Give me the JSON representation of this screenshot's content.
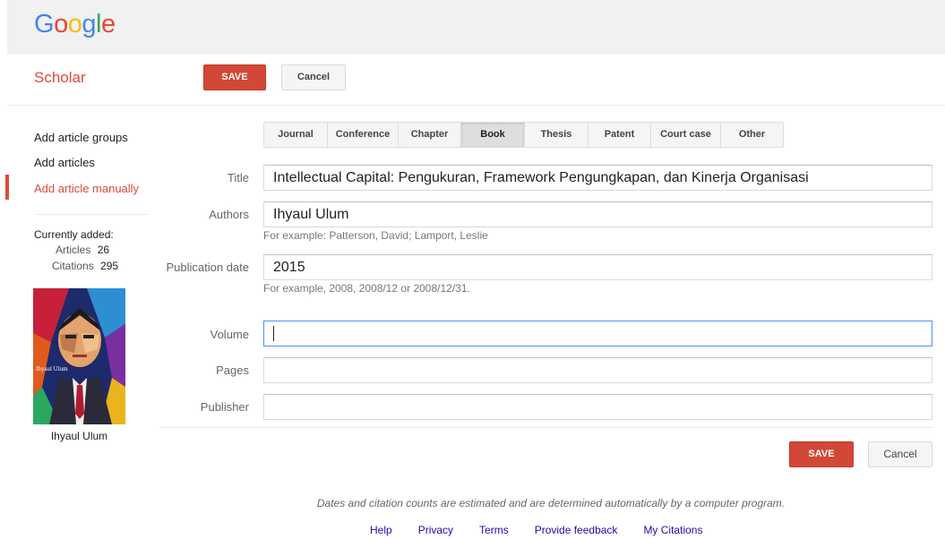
{
  "header": {
    "logo_letters": [
      {
        "ch": "G",
        "color": "#4285f4"
      },
      {
        "ch": "o",
        "color": "#ea4335"
      },
      {
        "ch": "o",
        "color": "#fbbc05"
      },
      {
        "ch": "g",
        "color": "#4285f4"
      },
      {
        "ch": "l",
        "color": "#34a853"
      },
      {
        "ch": "e",
        "color": "#ea4335"
      }
    ],
    "section_title": "Scholar",
    "save_label": "SAVE",
    "cancel_label": "Cancel"
  },
  "sidebar": {
    "items": [
      {
        "label": "Add article groups"
      },
      {
        "label": "Add articles"
      },
      {
        "label": "Add article manually",
        "active": true
      }
    ],
    "currently_added_label": "Currently added:",
    "articles_label": "Articles",
    "articles_count": "26",
    "citations_label": "Citations",
    "citations_count": "295",
    "profile_name": "Ihyaul Ulum",
    "photo_caption": "Ihyaul Ulum"
  },
  "tabs": [
    {
      "label": "Journal"
    },
    {
      "label": "Conference"
    },
    {
      "label": "Chapter"
    },
    {
      "label": "Book",
      "selected": true
    },
    {
      "label": "Thesis"
    },
    {
      "label": "Patent"
    },
    {
      "label": "Court case"
    },
    {
      "label": "Other"
    }
  ],
  "form": {
    "title_label": "Title",
    "title_value": "Intellectual Capital: Pengukuran, Framework Pengungkapan, dan Kinerja Organisasi",
    "authors_label": "Authors",
    "authors_value": "Ihyaul Ulum",
    "authors_hint": "For example: Patterson, David; Lamport, Leslie",
    "pubdate_label": "Publication date",
    "pubdate_value": "2015",
    "pubdate_hint": "For example, 2008, 2008/12 or 2008/12/31.",
    "volume_label": "Volume",
    "volume_value": "",
    "pages_label": "Pages",
    "pages_value": "",
    "publisher_label": "Publisher",
    "publisher_value": ""
  },
  "bottom_actions": {
    "save_label": "SAVE",
    "cancel_label": "Cancel"
  },
  "footer": {
    "note": "Dates and citation counts are estimated and are determined automatically by a computer program.",
    "links": [
      "Help",
      "Privacy",
      "Terms",
      "Provide feedback",
      "My Citations"
    ]
  }
}
